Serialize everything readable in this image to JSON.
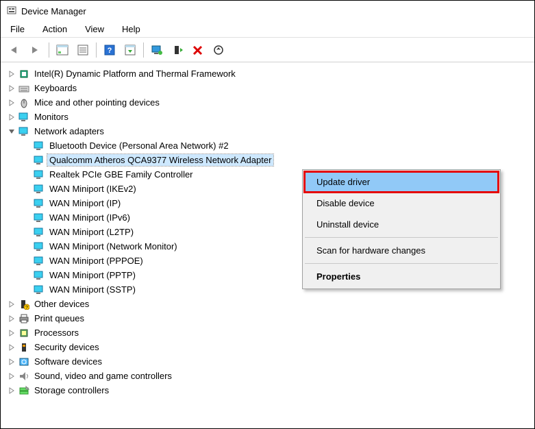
{
  "window": {
    "title": "Device Manager"
  },
  "menu": {
    "file": "File",
    "action": "Action",
    "view": "View",
    "help": "Help"
  },
  "tree": {
    "categories": [
      {
        "label": "Intel(R) Dynamic Platform and Thermal Framework",
        "icon": "chip"
      },
      {
        "label": "Keyboards",
        "icon": "keyboard"
      },
      {
        "label": "Mice and other pointing devices",
        "icon": "mouse"
      },
      {
        "label": "Monitors",
        "icon": "monitor"
      },
      {
        "label": "Network adapters",
        "icon": "network",
        "expanded": true,
        "children": [
          {
            "label": "Bluetooth Device (Personal Area Network) #2"
          },
          {
            "label": "Qualcomm Atheros QCA9377 Wireless Network Adapter",
            "selected": true
          },
          {
            "label": "Realtek PCIe GBE Family Controller"
          },
          {
            "label": "WAN Miniport (IKEv2)"
          },
          {
            "label": "WAN Miniport (IP)"
          },
          {
            "label": "WAN Miniport (IPv6)"
          },
          {
            "label": "WAN Miniport (L2TP)"
          },
          {
            "label": "WAN Miniport (Network Monitor)"
          },
          {
            "label": "WAN Miniport (PPPOE)"
          },
          {
            "label": "WAN Miniport (PPTP)"
          },
          {
            "label": "WAN Miniport (SSTP)"
          }
        ]
      },
      {
        "label": "Other devices",
        "icon": "other"
      },
      {
        "label": "Print queues",
        "icon": "printer"
      },
      {
        "label": "Processors",
        "icon": "cpu"
      },
      {
        "label": "Security devices",
        "icon": "security"
      },
      {
        "label": "Software devices",
        "icon": "software"
      },
      {
        "label": "Sound, video and game controllers",
        "icon": "sound"
      },
      {
        "label": "Storage controllers",
        "icon": "storage"
      }
    ]
  },
  "context_menu": {
    "update": "Update driver",
    "disable": "Disable device",
    "uninstall": "Uninstall device",
    "scan": "Scan for hardware changes",
    "properties": "Properties"
  }
}
